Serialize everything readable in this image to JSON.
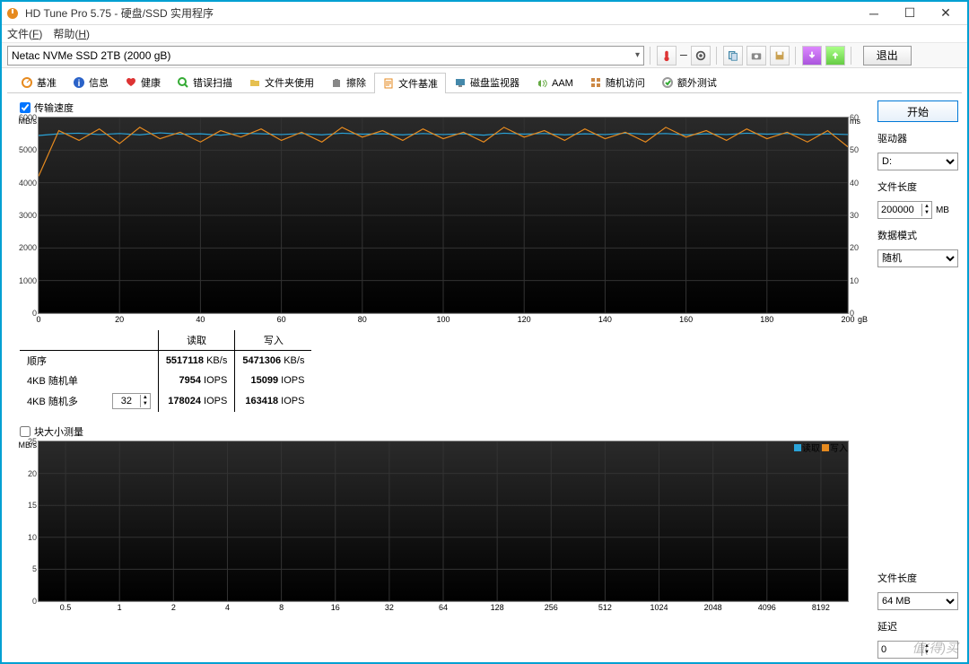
{
  "window": {
    "title": "HD Tune Pro 5.75 - 硬盘/SSD 实用程序"
  },
  "menu": {
    "file": "文件(F)",
    "help": "帮助(H)"
  },
  "toolbar": {
    "drive": "Netac NVMe SSD 2TB (2000 gB)",
    "exit": "退出"
  },
  "tabs": [
    {
      "label": "基准"
    },
    {
      "label": "信息"
    },
    {
      "label": "健康"
    },
    {
      "label": "错误扫描"
    },
    {
      "label": "文件夹使用"
    },
    {
      "label": "擦除"
    },
    {
      "label": "文件基准",
      "active": true
    },
    {
      "label": "磁盘监视器"
    },
    {
      "label": "AAM"
    },
    {
      "label": "随机访问"
    },
    {
      "label": "额外测试"
    }
  ],
  "check_transfer": "传输速度",
  "check_blocksize": "块大小测量",
  "chart_data": [
    {
      "type": "line",
      "title": "传输速度",
      "y_left_unit": "MB/s",
      "y_right_unit": "ms",
      "y_left_ticks": [
        0,
        1000,
        2000,
        3000,
        4000,
        5000,
        6000
      ],
      "y_right_ticks": [
        0,
        10,
        20,
        30,
        40,
        50,
        60
      ],
      "x_ticks": [
        0,
        20,
        40,
        60,
        80,
        100,
        120,
        140,
        160,
        180,
        200
      ],
      "x_unit": "gB",
      "ylim_left": [
        0,
        6000
      ],
      "ylim_right": [
        0,
        60
      ],
      "xlim": [
        0,
        200
      ],
      "series": [
        {
          "name": "读取",
          "color": "#2aa3d8",
          "x": [
            0,
            5,
            10,
            15,
            20,
            25,
            30,
            35,
            40,
            45,
            50,
            55,
            60,
            65,
            70,
            75,
            80,
            85,
            90,
            95,
            100,
            105,
            110,
            115,
            120,
            125,
            130,
            135,
            140,
            145,
            150,
            155,
            160,
            165,
            170,
            175,
            180,
            185,
            190,
            195,
            200
          ],
          "y": [
            5450,
            5500,
            5520,
            5480,
            5510,
            5470,
            5530,
            5490,
            5500,
            5460,
            5520,
            5500,
            5480,
            5510,
            5470,
            5520,
            5490,
            5500,
            5470,
            5510,
            5480,
            5500,
            5460,
            5520,
            5490,
            5510,
            5470,
            5500,
            5480,
            5520,
            5490,
            5510,
            5470,
            5500,
            5480,
            5520,
            5490,
            5510,
            5470,
            5500,
            5480
          ]
        },
        {
          "name": "写入",
          "color": "#e68a1f",
          "x": [
            0,
            5,
            10,
            15,
            20,
            25,
            30,
            35,
            40,
            45,
            50,
            55,
            60,
            65,
            70,
            75,
            80,
            85,
            90,
            95,
            100,
            105,
            110,
            115,
            120,
            125,
            130,
            135,
            140,
            145,
            150,
            155,
            160,
            165,
            170,
            175,
            180,
            185,
            190,
            195,
            200
          ],
          "y": [
            4200,
            5600,
            5300,
            5650,
            5200,
            5700,
            5350,
            5550,
            5250,
            5600,
            5400,
            5650,
            5300,
            5550,
            5250,
            5700,
            5400,
            5600,
            5300,
            5650,
            5350,
            5550,
            5250,
            5700,
            5400,
            5600,
            5300,
            5650,
            5350,
            5550,
            5250,
            5700,
            5400,
            5600,
            5300,
            5650,
            5350,
            5550,
            5250,
            5600,
            5100
          ]
        }
      ]
    },
    {
      "type": "line",
      "title": "块大小测量",
      "y_left_unit": "MB/s",
      "y_left_ticks": [
        0,
        5,
        10,
        15,
        20,
        25
      ],
      "x_ticks": [
        0.5,
        1,
        2,
        4,
        8,
        16,
        32,
        64,
        128,
        256,
        512,
        1024,
        2048,
        4096,
        8192
      ],
      "ylim_left": [
        0,
        25
      ],
      "series": [
        {
          "name": "读取",
          "color": "#2aa3d8",
          "x": [],
          "y": []
        },
        {
          "name": "写入",
          "color": "#e68a1f",
          "x": [],
          "y": []
        }
      ]
    }
  ],
  "results": {
    "col_read": "读取",
    "col_write": "写入",
    "rows": [
      {
        "label": "顺序",
        "read_v": "5517118",
        "read_u": "KB/s",
        "write_v": "5471306",
        "write_u": "KB/s"
      },
      {
        "label": "4KB 随机单",
        "read_v": "7954",
        "read_u": "IOPS",
        "write_v": "15099",
        "write_u": "IOPS"
      },
      {
        "label": "4KB 随机多",
        "spin": "32",
        "read_v": "178024",
        "read_u": "IOPS",
        "write_v": "163418",
        "write_u": "IOPS"
      }
    ]
  },
  "side": {
    "start": "开始",
    "drive_lbl": "驱动器",
    "drive_val": "D:",
    "filelen_lbl": "文件长度",
    "filelen_val": "200000",
    "filelen_unit": "MB",
    "mode_lbl": "数据模式",
    "mode_val": "随机",
    "filelen2_lbl": "文件长度",
    "filelen2_val": "64 MB",
    "delay_lbl": "延迟",
    "delay_val": "0"
  },
  "watermark": "值(得)买",
  "colors": {
    "read": "#2aa3d8",
    "write": "#e68a1f"
  }
}
